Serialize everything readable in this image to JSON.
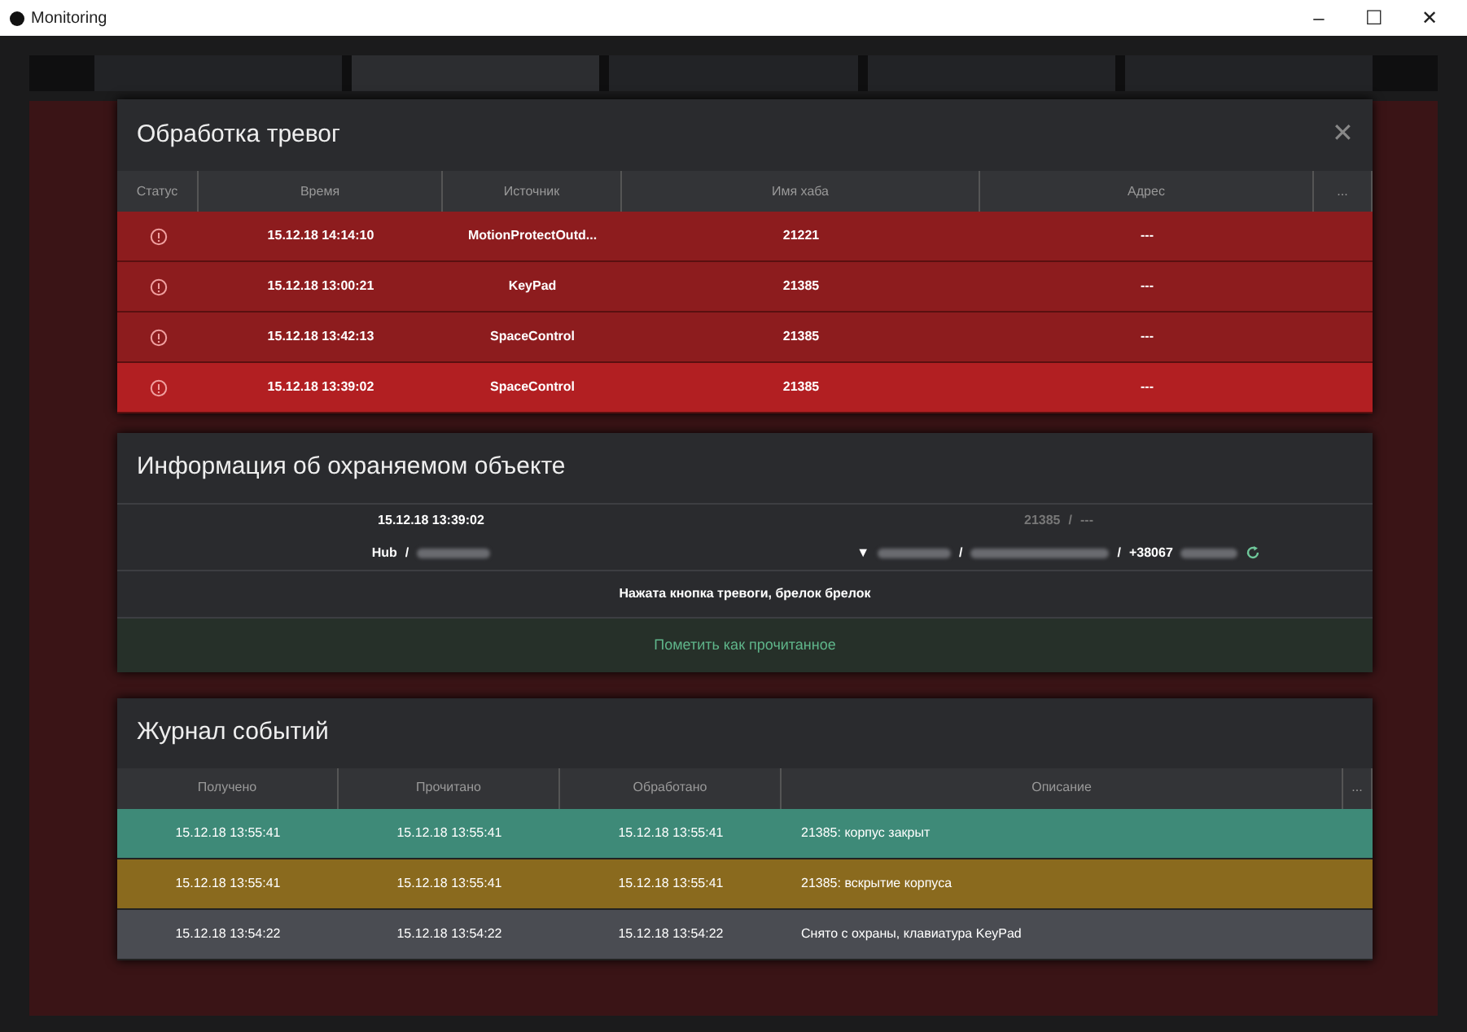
{
  "window": {
    "title": "Monitoring",
    "controls": [
      "–",
      "☐",
      "✕"
    ]
  },
  "alarms": {
    "title": "Обработка тревог",
    "close": "✕",
    "columns": [
      "Статус",
      "Время",
      "Источник",
      "Имя хаба",
      "Адрес",
      "..."
    ],
    "rows": [
      {
        "time": "15.12.18  14:14:10",
        "source": "MotionProtectOutd...",
        "hub": "21221",
        "address": "---",
        "selected": false
      },
      {
        "time": "15.12.18  13:00:21",
        "source": "KeyPad",
        "hub": "21385",
        "address": "---",
        "selected": false
      },
      {
        "time": "15.12.18  13:42:13",
        "source": "SpaceControl",
        "hub": "21385",
        "address": "---",
        "selected": false
      },
      {
        "time": "15.12.18  13:39:02",
        "source": "SpaceControl",
        "hub": "21385",
        "address": "---",
        "selected": true
      }
    ]
  },
  "info": {
    "title": "Информация об охраняемом объекте",
    "datetime": "15.12.18 13:39:02",
    "hub_id": "21385",
    "hub_sep": "/",
    "hub_addr": "---",
    "hub_label": "Hub",
    "hub_label_sep": "/",
    "contact_arrow": "▼",
    "sep1": "/",
    "sep2": "/",
    "phone": "+38067",
    "message": "Нажата кнопка тревоги, брелок брелок",
    "mark_button": "Пометить как прочитанное"
  },
  "journal": {
    "title": "Журнал событий",
    "columns": [
      "Получено",
      "Прочитано",
      "Обработано",
      "Описание",
      "..."
    ],
    "rows": [
      {
        "received": "15.12.18  13:55:41",
        "read": "15.12.18  13:55:41",
        "processed": "15.12.18  13:55:41",
        "description": "21385: корпус закрыт",
        "color": "#3e8a78"
      },
      {
        "received": "15.12.18  13:55:41",
        "read": "15.12.18  13:55:41",
        "processed": "15.12.18  13:55:41",
        "description": "21385: вскрытие корпуса",
        "color": "#8a6a1e"
      },
      {
        "received": "15.12.18  13:54:22",
        "read": "15.12.18  13:54:22",
        "processed": "15.12.18  13:54:22",
        "description": "Снято с охраны, клавиатура KeyPad",
        "color": "#4a4c52"
      }
    ]
  }
}
